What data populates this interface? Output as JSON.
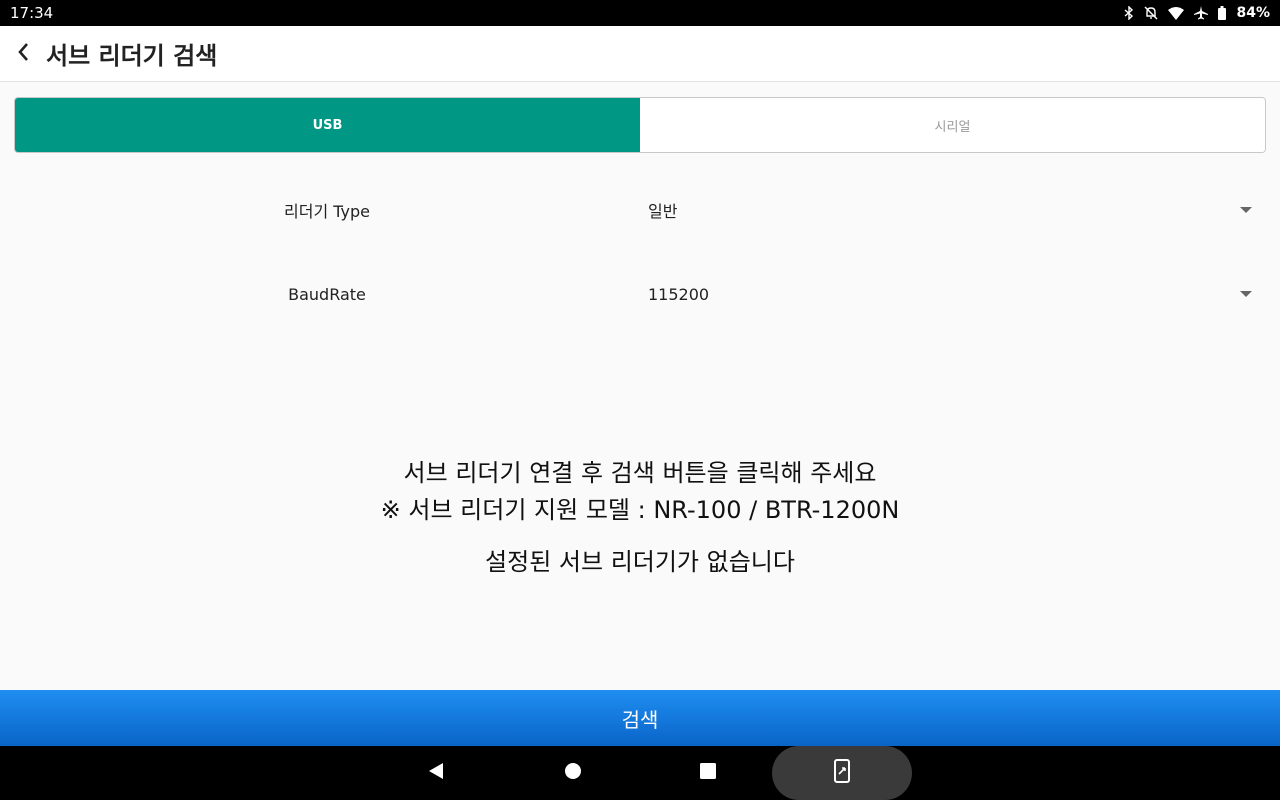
{
  "status_bar": {
    "time": "17:34",
    "battery": "84%",
    "icons": [
      "bluetooth-icon",
      "notifications-off-icon",
      "wifi-icon",
      "airplane-icon",
      "battery-icon"
    ]
  },
  "app_bar": {
    "title": "서브 리더기 검색",
    "back_icon": "chevron-left-icon"
  },
  "tabs": [
    {
      "label": "USB",
      "active": true
    },
    {
      "label": "시리얼",
      "active": false
    }
  ],
  "form": {
    "reader_type": {
      "label": "리더기 Type",
      "value": "일반"
    },
    "baud_rate": {
      "label": "BaudRate",
      "value": "115200"
    }
  },
  "messages": {
    "line1": "서브 리더기 연결 후 검색 버튼을 클릭해 주세요",
    "line2": "※ 서브 리더기 지원 모델 : NR-100 / BTR-1200N",
    "empty": "설정된 서브 리더기가 없습니다"
  },
  "search_button": {
    "label": "검색"
  },
  "colors": {
    "accent": "#009784",
    "button": "#1877e0",
    "status_bar": "#000000"
  },
  "nav_bar": {
    "icons": [
      "back-triangle-icon",
      "home-circle-icon",
      "recents-square-icon",
      "screen-rotate-icon"
    ]
  }
}
